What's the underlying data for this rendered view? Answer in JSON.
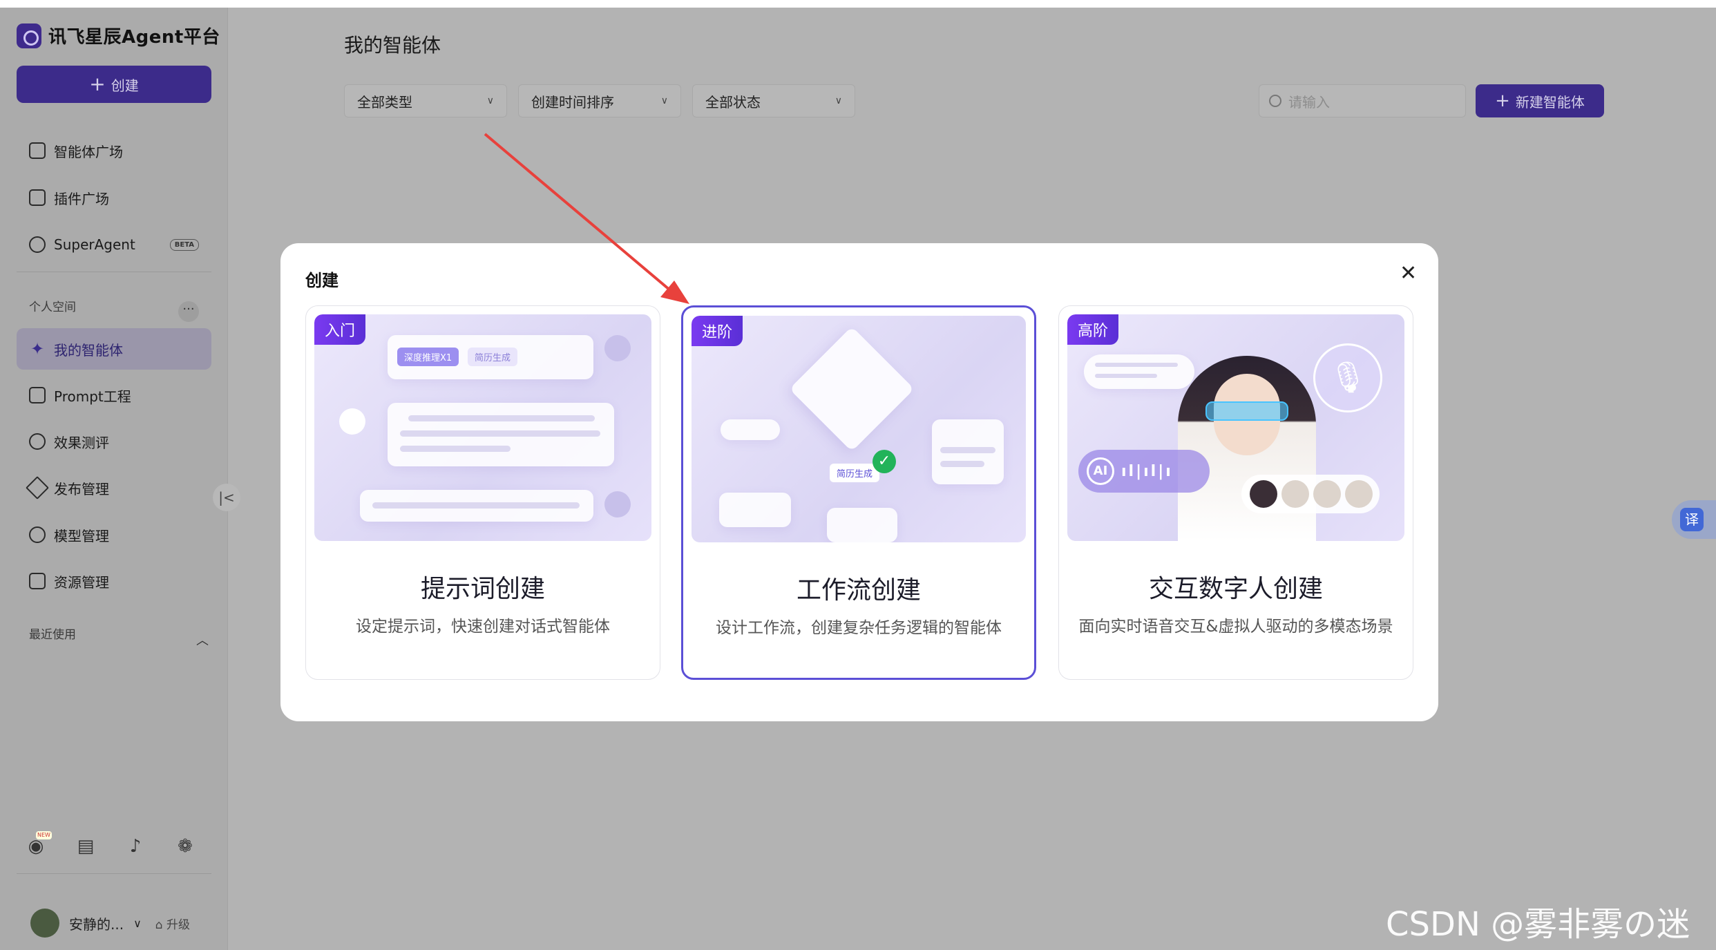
{
  "brand": {
    "name": "讯飞星辰Agent平台"
  },
  "sidebar": {
    "create_label": "创建",
    "nav": [
      {
        "label": "智能体广场"
      },
      {
        "label": "插件广场"
      },
      {
        "label": "SuperAgent",
        "badge": "BETA"
      }
    ],
    "personal_space_label": "个人空间",
    "personal": [
      {
        "label": "我的智能体"
      },
      {
        "label": "Prompt工程"
      },
      {
        "label": "效果测评"
      },
      {
        "label": "发布管理"
      },
      {
        "label": "模型管理"
      },
      {
        "label": "资源管理"
      }
    ],
    "recent_label": "最近使用",
    "user": {
      "name": "安静的...",
      "upgrade": "升级"
    },
    "new_badge": "NEW"
  },
  "main": {
    "title": "我的智能体",
    "filters": [
      "全部类型",
      "创建时间排序",
      "全部状态"
    ],
    "search_placeholder": "请输入",
    "new_agent_label": "新建智能体"
  },
  "translate": {
    "label": "译"
  },
  "modal": {
    "title": "创建",
    "cards": [
      {
        "badge": "入门",
        "title": "提示词创建",
        "desc": "设定提示词，快速创建对话式智能体",
        "chips": [
          "深度推理X1",
          "简历生成"
        ]
      },
      {
        "badge": "进阶",
        "title": "工作流创建",
        "desc": "设计工作流，创建复杂任务逻辑的智能体",
        "chip": "简历生成"
      },
      {
        "badge": "高阶",
        "title": "交互数字人创建",
        "desc": "面向实时语音交互&虚拟人驱动的多模态场景",
        "ai_label": "AI"
      }
    ]
  },
  "watermark": "CSDN @雾非雾の迷惘",
  "colors": {
    "accent": "#5b4fd6",
    "annotation_arrow": "#e8413c"
  }
}
